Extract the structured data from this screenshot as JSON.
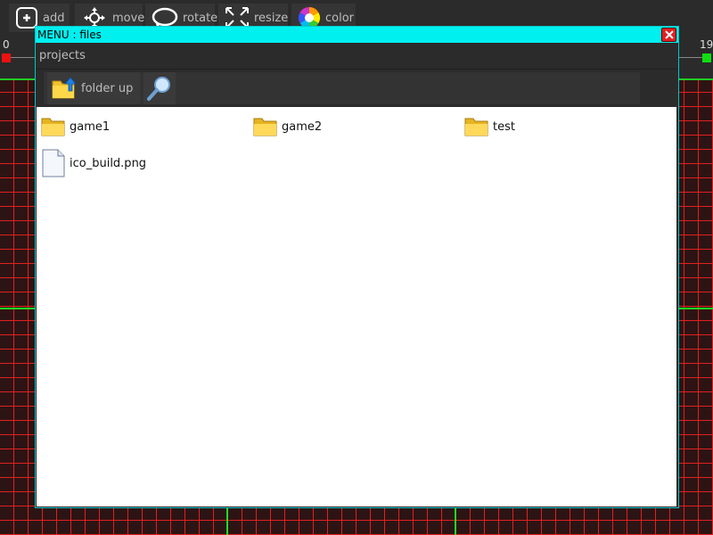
{
  "toolbar": {
    "tools": [
      {
        "label": "add",
        "icon": "add-icon"
      },
      {
        "label": "move",
        "icon": "move-icon"
      },
      {
        "label": "rotate",
        "icon": "rotate-icon"
      },
      {
        "label": "resize",
        "icon": "resize-icon"
      },
      {
        "label": "color",
        "icon": "color-wheel-icon"
      }
    ]
  },
  "timeline": {
    "start_label": "0",
    "end_label": "19",
    "start_marker_color": "#ee1111",
    "end_marker_color": "#11dd11"
  },
  "dialog": {
    "title": "MENU : files",
    "path": "projects",
    "folder_up_label": "folder up",
    "title_color": "#00f0f0",
    "items": [
      {
        "name": "game1",
        "type": "folder"
      },
      {
        "name": "game2",
        "type": "folder"
      },
      {
        "name": "test",
        "type": "folder"
      },
      {
        "name": "ico_build.png",
        "type": "file"
      }
    ]
  },
  "colors": {
    "grid_line": "#e02020",
    "grid_major": "#22dd22",
    "dialog_border": "#00c8c8"
  }
}
